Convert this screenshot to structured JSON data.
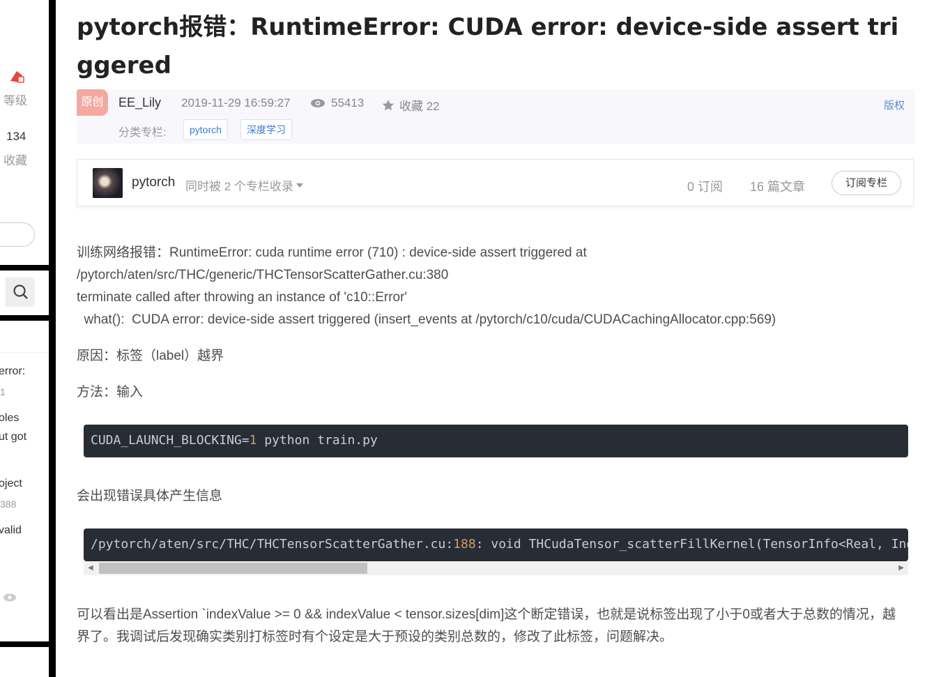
{
  "sidebar": {
    "level_label": "等级",
    "count_value": "134",
    "favorites_label": "收藏",
    "snippets": [
      {
        "text": "error:",
        "sub": "1"
      },
      {
        "text": "oles",
        "sub": ""
      },
      {
        "text": "ut got",
        "sub": ""
      },
      {
        "text": "oject",
        "sub": "388"
      },
      {
        "text": "valid",
        "sub": ""
      }
    ]
  },
  "article": {
    "title": "pytorch报错：RuntimeError: CUDA error: device-side assert triggered",
    "badge": "原创",
    "author": "EE_Lily",
    "date": "2019-11-29 16:59:27",
    "views": "55413",
    "favorites": "收藏 22",
    "copyright": "版权",
    "category_label": "分类专栏:",
    "tags": [
      "pytorch",
      "深度学习"
    ]
  },
  "column": {
    "name": "pytorch",
    "also_included": "同时被 2 个专栏收录",
    "subscribers": "0 订阅",
    "articles": "16 篇文章",
    "subscribe_button": "订阅专栏"
  },
  "content": {
    "error_lines": [
      "训练网络报错：RuntimeError: cuda runtime error (710) : device-side assert triggered at",
      "/pytorch/aten/src/THC/generic/THCTensorScatterGather.cu:380",
      "terminate called after throwing an instance of 'c10::Error'",
      "  what():  CUDA error: device-side assert triggered (insert_events at /pytorch/c10/cuda/CUDACachingAllocator.cpp:569)"
    ],
    "reason": "原因：标签（label）越界",
    "method": "方法：输入",
    "code1": {
      "prefix": "CUDA_LAUNCH_BLOCKING=",
      "number": "1",
      "suffix": " python train.py"
    },
    "info_text": "会出现错误具体产生信息",
    "code2": {
      "prefix": "/pytorch/aten/src/THC/THCTensorScatterGather.cu:",
      "number": "188",
      "suffix": ": void THCudaTensor_scatterFillKernel(TensorInfo<Real, IndexType"
    },
    "conclusion": "可以看出是Assertion `indexValue >= 0 && indexValue < tensor.sizes[dim]这个断定错误，也就是说标签出现了小于0或者大于总数的情况，越界了。我调试后发现确实类别打标签时有个设定是大于预设的类别总数的，修改了此标签，问题解决。"
  },
  "colors": {
    "badge": "#f4a9a0",
    "link": "#5b8fd1",
    "code_bg": "#282c34",
    "code_number": "#d19a66"
  }
}
